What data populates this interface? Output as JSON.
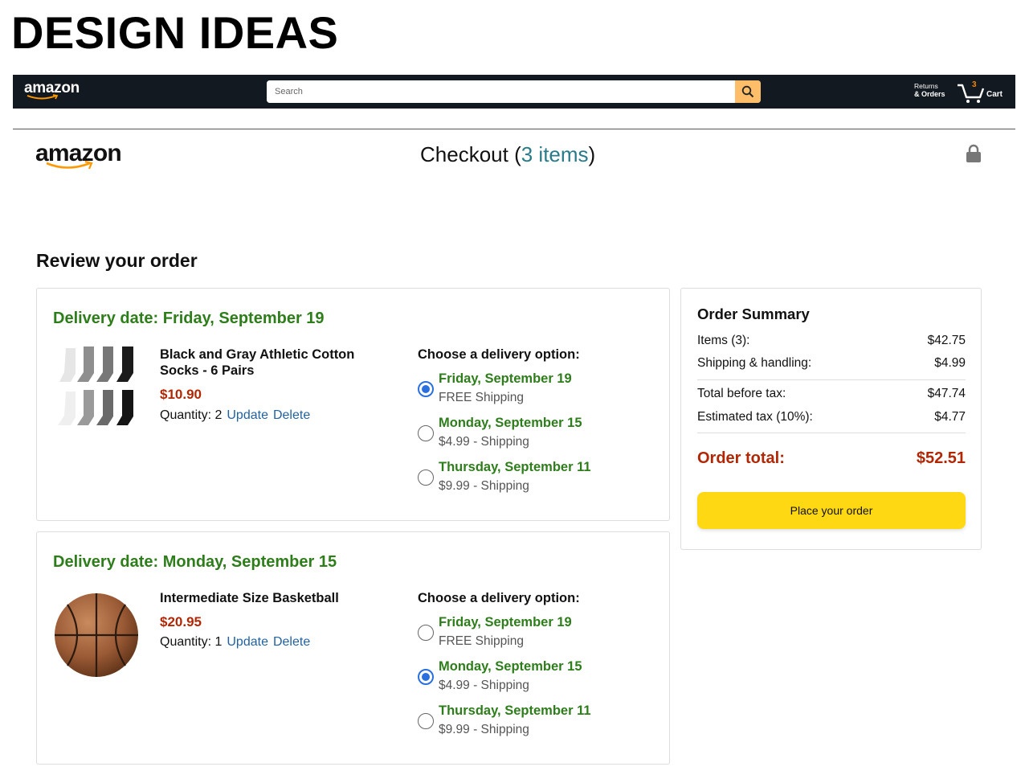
{
  "page": {
    "heading": "DESIGN IDEAS"
  },
  "navbar": {
    "logo": "amazon",
    "search_placeholder": "Search",
    "returns_line1": "Returns",
    "returns_line2": "& Orders",
    "cart_count": "3",
    "cart_label": "Cart"
  },
  "checkout": {
    "logo": "amazon",
    "title_prefix": "Checkout (",
    "title_items": "3 items",
    "title_suffix": ")",
    "review_title": "Review your order"
  },
  "shipments": [
    {
      "delivery_heading": "Delivery date: Friday, September 19",
      "product_name": "Black and Gray Athletic Cotton Socks - 6 Pairs",
      "price": "$10.90",
      "quantity": "Quantity: 2",
      "update_label": "Update",
      "delete_label": "Delete",
      "options_heading": "Choose a delivery option:",
      "options": [
        {
          "date": "Friday, September 19",
          "sub": "FREE Shipping",
          "selected": true
        },
        {
          "date": "Monday, September 15",
          "sub": "$4.99 - Shipping",
          "selected": false
        },
        {
          "date": "Thursday, September 11",
          "sub": "$9.99 - Shipping",
          "selected": false
        }
      ]
    },
    {
      "delivery_heading": "Delivery date: Monday, September 15",
      "product_name": "Intermediate Size Basketball",
      "price": "$20.95",
      "quantity": "Quantity: 1",
      "update_label": "Update",
      "delete_label": "Delete",
      "options_heading": "Choose a delivery option:",
      "options": [
        {
          "date": "Friday, September 19",
          "sub": "FREE Shipping",
          "selected": false
        },
        {
          "date": "Monday, September 15",
          "sub": "$4.99 - Shipping",
          "selected": true
        },
        {
          "date": "Thursday, September 11",
          "sub": "$9.99 - Shipping",
          "selected": false
        }
      ]
    }
  ],
  "summary": {
    "title": "Order Summary",
    "rows": [
      {
        "label": "Items (3):",
        "value": "$42.75"
      },
      {
        "label": "Shipping & handling:",
        "value": "$4.99"
      },
      {
        "label": "Total before tax:",
        "value": "$47.74"
      },
      {
        "label": "Estimated tax (10%):",
        "value": "$4.77"
      }
    ],
    "total_label": "Order total:",
    "total_value": "$52.51",
    "place_order_label": "Place your order"
  },
  "colors": {
    "nav_bg": "#131921",
    "search_button": "#febd69",
    "delivery_green": "#2e7d1b",
    "price_red": "#b12704",
    "link_blue": "#2162a1",
    "radio_blue": "#2a6fe0",
    "place_order_yellow": "#ffd814"
  },
  "icons": [
    "search-icon",
    "cart-icon",
    "lock-icon",
    "amazon-smile-logo"
  ]
}
